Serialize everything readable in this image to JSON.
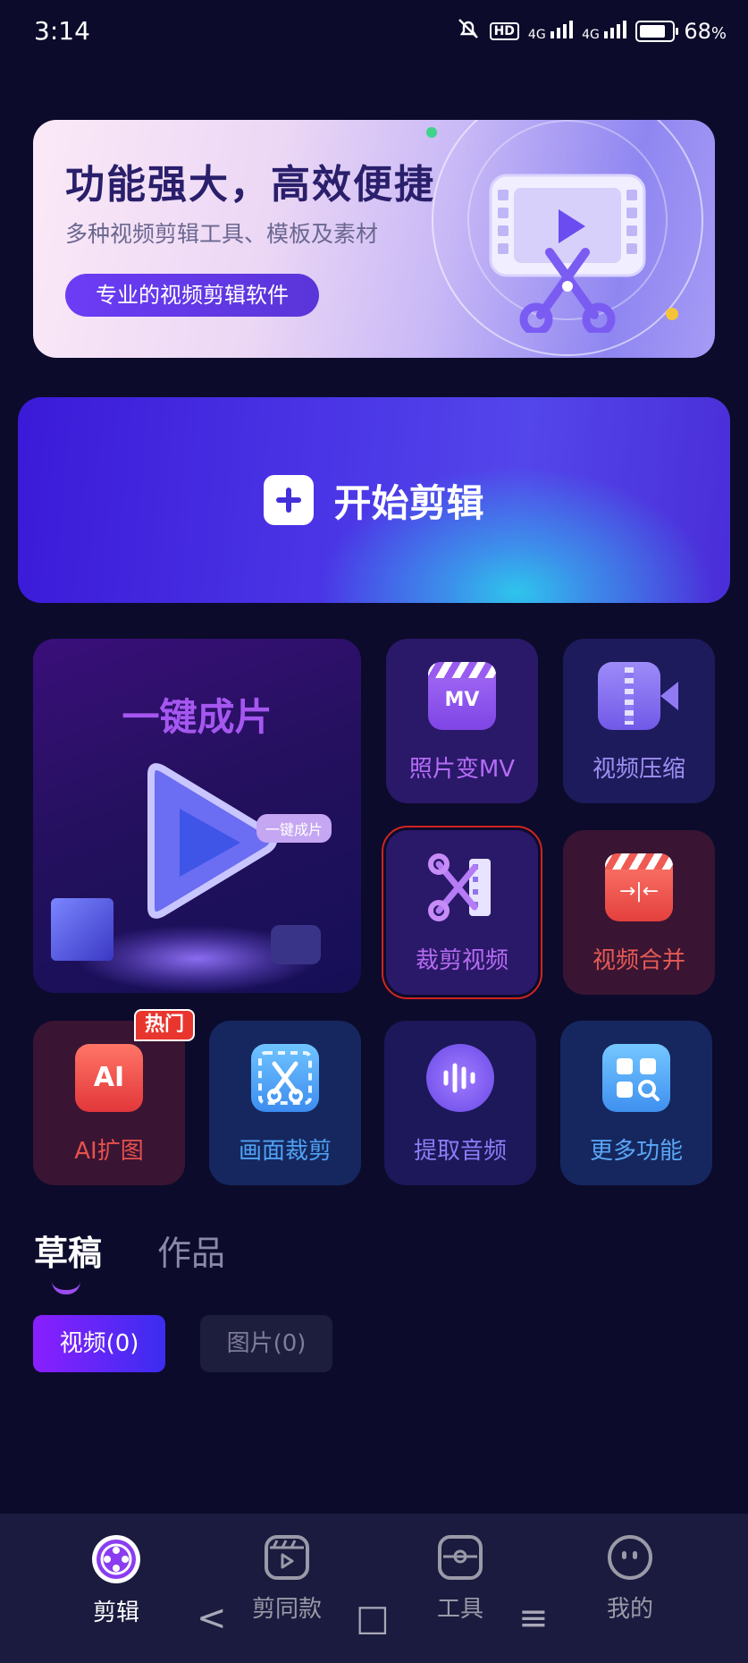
{
  "status_bar": {
    "time": "3:14",
    "hd": "HD",
    "net1": "4G",
    "net2": "4G",
    "battery": "68",
    "battery_unit": "%",
    "battery_level": 0.68
  },
  "banner": {
    "title": "功能强大，高效便捷",
    "subtitle": "多种视频剪辑工具、模板及素材",
    "button": "专业的视频剪辑软件"
  },
  "start_edit": {
    "label": "开始剪辑"
  },
  "features": {
    "one_click": {
      "title": "一键成片",
      "sticker": "一键成片"
    },
    "photo_mv": {
      "label": "照片变MV",
      "icon_text": "MV"
    },
    "video_compress": {
      "label": "视频压缩"
    },
    "crop_video": {
      "label": "裁剪视频"
    },
    "video_merge": {
      "label": "视频合并"
    },
    "ai_expand": {
      "label": "AI扩图",
      "badge": "热门",
      "icon_text": "AI"
    },
    "frame_crop": {
      "label": "画面裁剪"
    },
    "extract_audio": {
      "label": "提取音频"
    },
    "more": {
      "label": "更多功能"
    }
  },
  "colors": {
    "accent": "#9b4df2",
    "photo_mv_label": "#b46cf5",
    "compress_label": "#9e8ff2",
    "crop_label": "#b66cf0",
    "merge_label": "#e55b55",
    "ai_label": "#e5524c",
    "frame_label": "#4fa2f4",
    "audio_label": "#8c7cf5",
    "more_label": "#5aa6f5"
  },
  "tabs": {
    "draft": "草稿",
    "works": "作品"
  },
  "filters": {
    "video": "视频(0)",
    "image": "图片(0)"
  },
  "bottom_nav": [
    {
      "label": "剪辑",
      "icon": "film-reel-icon"
    },
    {
      "label": "剪同款",
      "icon": "clapper-play-icon"
    },
    {
      "label": "工具",
      "icon": "toolbox-icon"
    },
    {
      "label": "我的",
      "icon": "face-icon"
    }
  ],
  "system_nav": {
    "back": "<",
    "home": "□",
    "menu": "≡"
  }
}
